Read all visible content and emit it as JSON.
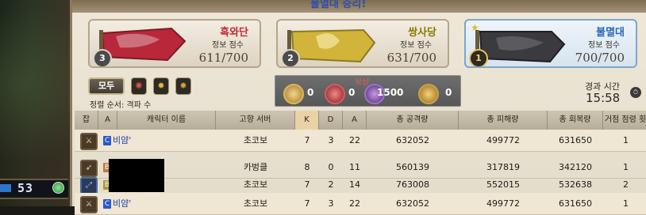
{
  "header": {
    "title": "불멸대 승리!"
  },
  "teams": [
    {
      "name": "흑와단",
      "score_label": "정보 점수",
      "score": "611/700",
      "rank": "3",
      "name_color": "#c0282e"
    },
    {
      "name": "쌍사당",
      "score_label": "정보 점수",
      "score": "631/700",
      "rank": "2",
      "name_color": "#8a7a00"
    },
    {
      "name": "불멸대",
      "score_label": "정보 점수",
      "score": "700/700",
      "rank": "1",
      "name_color": "#2b66b8"
    }
  ],
  "filters": {
    "all_label": "모두",
    "sort_label": "정렬 순서: 격파 수"
  },
  "rewards": {
    "title": "보상",
    "items": [
      {
        "icon": "gold-seal-icon",
        "value": "0"
      },
      {
        "icon": "red-seal-icon",
        "value": "0"
      },
      {
        "icon": "purple-seal-icon",
        "value": "1500"
      },
      {
        "icon": "medal-icon",
        "value": "0"
      }
    ]
  },
  "time": {
    "label": "경과 시간",
    "value": "15:58"
  },
  "table": {
    "headers": [
      "잡",
      "A",
      "캐릭터 이름",
      "고향 서버",
      "K",
      "D",
      "A",
      "총 공격량",
      "총 피해량",
      "총 회복량",
      "거점 점령 횟수"
    ],
    "rows": [
      {
        "tag": "C",
        "name": "비얌'",
        "server": "초코보",
        "k": "7",
        "d": "3",
        "a": "22",
        "dmg": "632052",
        "taken": "499772",
        "heal": "631650",
        "cap": "1"
      },
      {
        "tag": "B",
        "name": "",
        "server": "카벙클",
        "k": "8",
        "d": "0",
        "a": "11",
        "dmg": "560139",
        "taken": "317819",
        "heal": "342120",
        "cap": "1"
      },
      {
        "tag": "B",
        "name": "",
        "server": "초코보",
        "k": "7",
        "d": "2",
        "a": "14",
        "dmg": "763008",
        "taken": "552015",
        "heal": "532638",
        "cap": "2"
      },
      {
        "tag": "C",
        "name": "비얌'",
        "server": "초코보",
        "k": "7",
        "d": "3",
        "a": "22",
        "dmg": "632052",
        "taken": "499772",
        "heal": "631650",
        "cap": "1"
      }
    ]
  },
  "hud": {
    "level": "53"
  }
}
